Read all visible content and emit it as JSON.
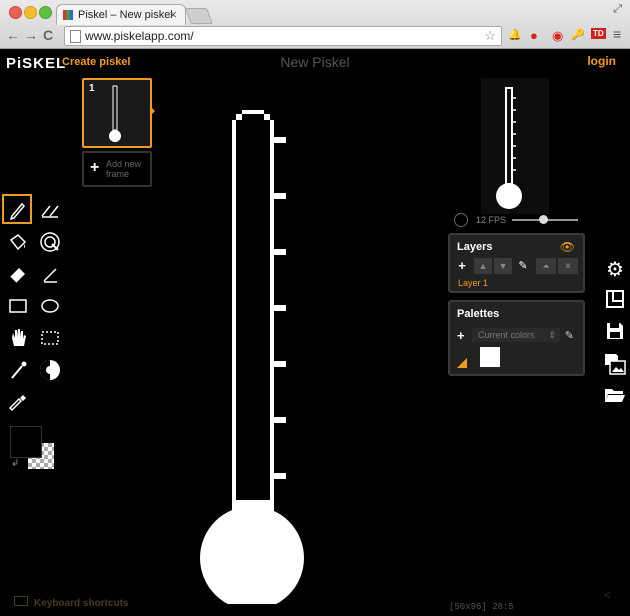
{
  "browser": {
    "tab_title": "Piskel – New piskel",
    "tab_close": "×",
    "url": "www.piskelapp.com/",
    "back": "←",
    "forward": "→",
    "reload": "C",
    "star": "☆",
    "ext_bell": "🔔",
    "ext_stop": "●",
    "ext_key": "🔑",
    "ext_badge": "TD",
    "menu": "≡",
    "resize": "⤢"
  },
  "app": {
    "logo": "PiSKEL",
    "create_link": "Create piskel",
    "title": "New Piskel",
    "login": "login"
  },
  "frames": {
    "frame_number": "1",
    "add_new_frame": "Add new frame",
    "add_symbol": "+"
  },
  "tools": [
    {
      "name": "pen-tool",
      "icon": "pencil-icon",
      "selected": true
    },
    {
      "name": "vertical-mirror-pen-tool",
      "icon": "mirror-pen-icon"
    },
    {
      "name": "paint-bucket-tool",
      "icon": "bucket-icon"
    },
    {
      "name": "paint-same-color-tool",
      "icon": "same-color-icon"
    },
    {
      "name": "eraser-tool",
      "icon": "eraser-icon"
    },
    {
      "name": "stroke-tool",
      "icon": "stroke-icon"
    },
    {
      "name": "rectangle-tool",
      "icon": "rectangle-icon"
    },
    {
      "name": "circle-tool",
      "icon": "circle-icon"
    },
    {
      "name": "move-tool",
      "icon": "hand-icon"
    },
    {
      "name": "rectangle-select-tool",
      "icon": "dashed-rect-icon"
    },
    {
      "name": "shape-select-tool",
      "icon": "magic-wand-icon"
    },
    {
      "name": "lighten-tool",
      "icon": "lighten-icon"
    },
    {
      "name": "color-picker-tool",
      "icon": "eyedropper-icon"
    }
  ],
  "colors": {
    "primary": "#000000",
    "secondary": "transparent",
    "accent": "#f29c1f"
  },
  "preview": {
    "fps_label": "12 FPS",
    "fps": 12
  },
  "layers": {
    "title": "Layers",
    "add": "+",
    "layer_names": [
      "Layer 1"
    ]
  },
  "palettes": {
    "title": "Palettes",
    "add": "+",
    "selected": "Current colors",
    "dropdown_arrow": "⇕",
    "edit": "✎",
    "swatches": [
      "#ffffff"
    ]
  },
  "right_tools": [
    {
      "name": "settings-button",
      "icon": "gear-icon",
      "glyph": "⚙"
    },
    {
      "name": "resize-button",
      "icon": "resize-icon",
      "glyph": "⧉"
    },
    {
      "name": "save-button",
      "icon": "floppy-icon",
      "glyph": "🖫"
    },
    {
      "name": "export-button",
      "icon": "image-export-icon",
      "glyph": "🖼"
    },
    {
      "name": "import-button",
      "icon": "folder-icon",
      "glyph": "📂"
    }
  ],
  "footer": {
    "keyboard_shortcuts": "Keyboard shortcuts",
    "coords": "[50x96] 28:5",
    "collapse": "<"
  }
}
